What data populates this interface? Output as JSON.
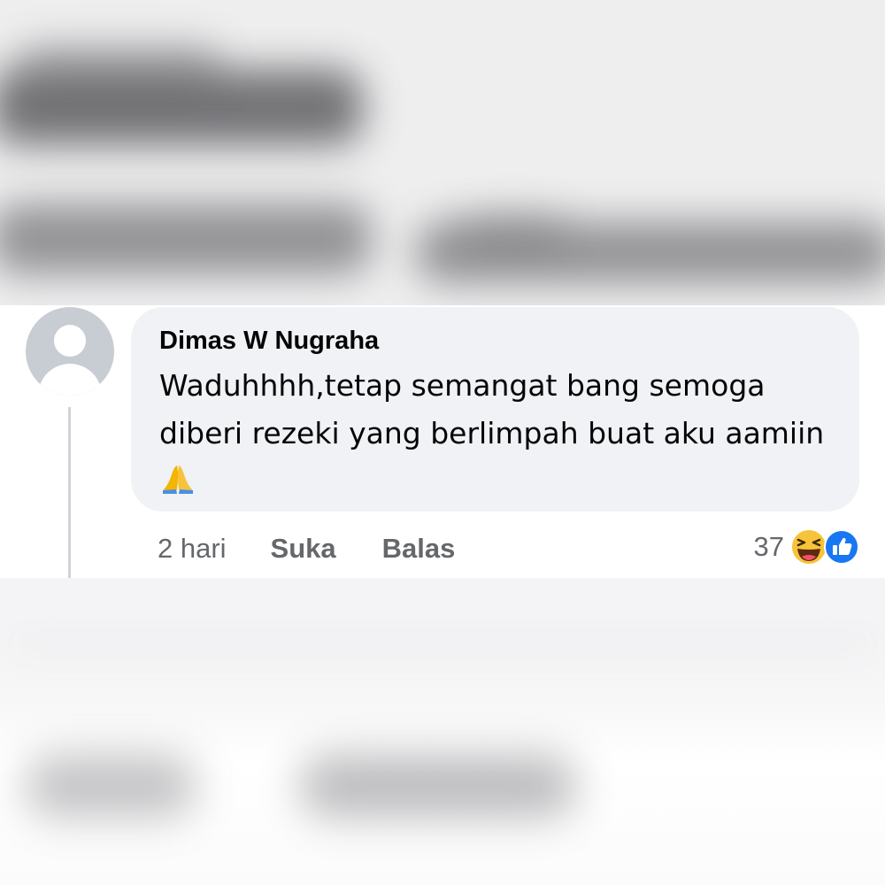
{
  "comment": {
    "author": "Dimas W Nugraha",
    "text": "Waduhhhh,tetap semangat bang semoga diberi rezeki yang berlimpah buat aku aamiin",
    "trailing_emoji": "folded-hands-emoji"
  },
  "actions": {
    "time": "2 hari",
    "like_label": "Suka",
    "reply_label": "Balas"
  },
  "reactions": {
    "count": "37",
    "icons": [
      "laughing-reaction-icon",
      "like-reaction-icon"
    ]
  },
  "colors": {
    "bubble": "#f0f2f5",
    "secondary_text": "#65676b",
    "like_blue": "#1877f2",
    "haha_yellow": "#f7c33a"
  }
}
